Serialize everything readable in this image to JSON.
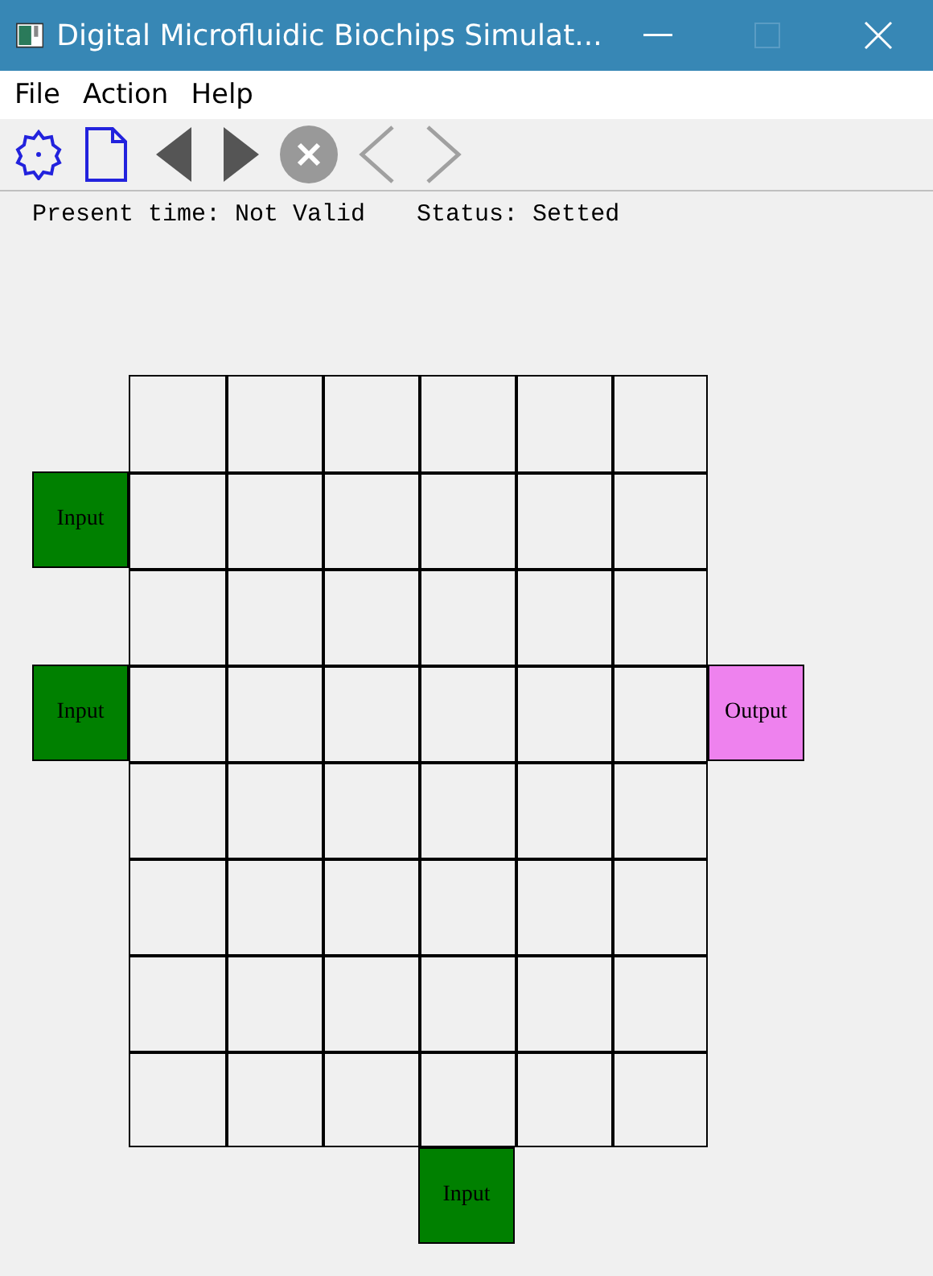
{
  "window": {
    "title": "Digital Microfluidic Biochips Simulat..."
  },
  "menu": [
    "File",
    "Action",
    "Help"
  ],
  "toolbar": [
    {
      "kind": "settings",
      "disabled": false
    },
    {
      "kind": "new",
      "disabled": false
    },
    {
      "kind": "back",
      "disabled": false
    },
    {
      "kind": "forward",
      "disabled": false
    },
    {
      "kind": "stop",
      "disabled": false
    },
    {
      "kind": "prev",
      "disabled": true
    },
    {
      "kind": "next",
      "disabled": true
    }
  ],
  "status": {
    "present_time": "Present time: Not Valid",
    "status": "Status: Setted"
  },
  "grid": {
    "rows": [
      {
        "cells": [
          {
            "kind": "electrode"
          },
          {
            "kind": "electrode"
          },
          {
            "kind": "electrode"
          },
          {
            "kind": "electrode"
          },
          {
            "kind": "electrode"
          },
          {
            "kind": "electrode"
          }
        ]
      },
      {
        "port_left": {
          "label": "Input",
          "kind": "input"
        },
        "cells": [
          {
            "kind": "electrode"
          },
          {
            "kind": "electrode"
          },
          {
            "kind": "electrode"
          },
          {
            "kind": "electrode"
          },
          {
            "kind": "electrode"
          },
          {
            "kind": "electrode"
          }
        ]
      },
      {
        "cells": [
          {
            "kind": "electrode"
          },
          {
            "kind": "electrode"
          },
          {
            "kind": "electrode"
          },
          {
            "kind": "electrode"
          },
          {
            "kind": "electrode"
          },
          {
            "kind": "electrode"
          }
        ]
      },
      {
        "port_left": {
          "label": "Input",
          "kind": "input"
        },
        "port_right": {
          "label": "Output",
          "kind": "output"
        },
        "cells": [
          {
            "kind": "electrode"
          },
          {
            "kind": "electrode"
          },
          {
            "kind": "electrode"
          },
          {
            "kind": "electrode"
          },
          {
            "kind": "electrode"
          },
          {
            "kind": "electrode"
          }
        ]
      },
      {
        "cells": [
          {
            "kind": "electrode"
          },
          {
            "kind": "electrode"
          },
          {
            "kind": "electrode"
          },
          {
            "kind": "electrode"
          },
          {
            "kind": "electrode"
          },
          {
            "kind": "electrode"
          }
        ]
      },
      {
        "cells": [
          {
            "kind": "electrode"
          },
          {
            "kind": "electrode"
          },
          {
            "kind": "electrode"
          },
          {
            "kind": "electrode"
          },
          {
            "kind": "electrode"
          },
          {
            "kind": "electrode"
          }
        ]
      },
      {
        "cells": [
          {
            "kind": "electrode"
          },
          {
            "kind": "electrode"
          },
          {
            "kind": "electrode"
          },
          {
            "kind": "electrode"
          },
          {
            "kind": "electrode"
          },
          {
            "kind": "electrode"
          }
        ]
      },
      {
        "cells": [
          {
            "kind": "electrode"
          },
          {
            "kind": "electrode"
          },
          {
            "kind": "electrode"
          },
          {
            "kind": "electrode",
            "port_below": {
              "label": "Input",
              "kind": "input"
            }
          },
          {
            "kind": "electrode"
          },
          {
            "kind": "electrode"
          }
        ]
      }
    ]
  }
}
